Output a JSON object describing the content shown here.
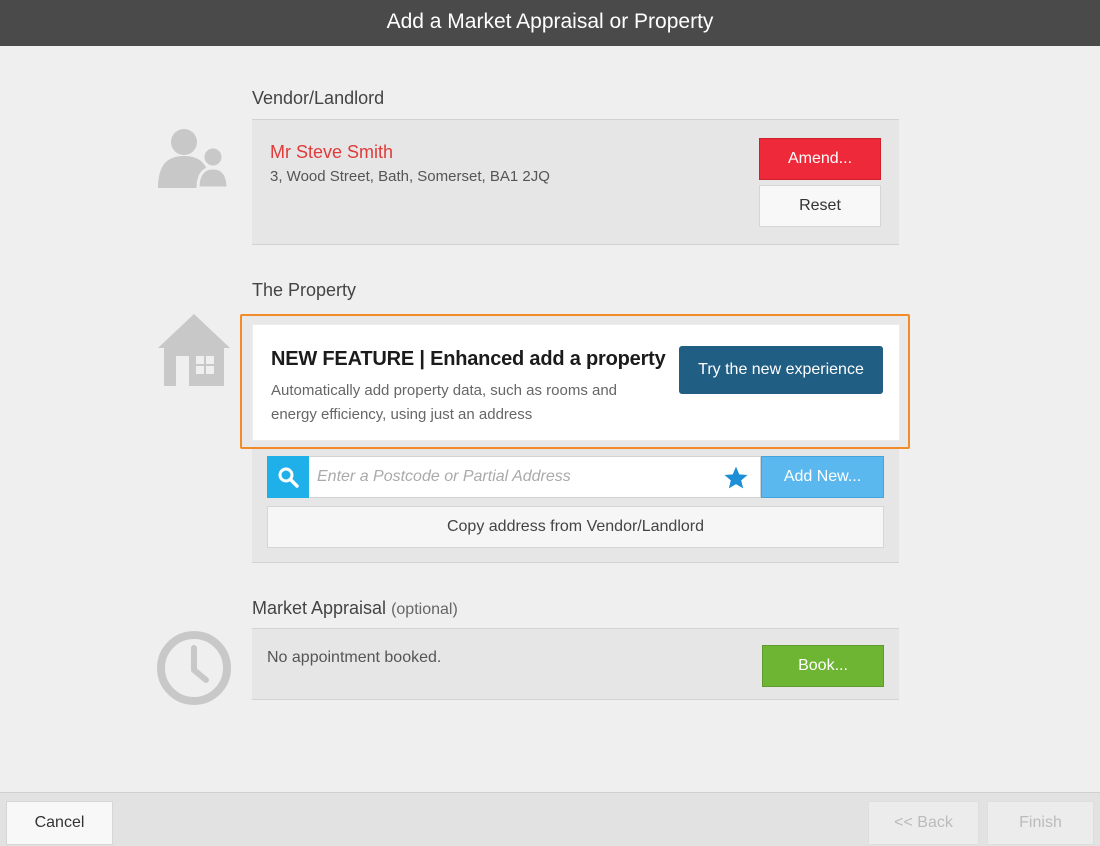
{
  "window": {
    "title": "Add a Market Appraisal or Property"
  },
  "vendor": {
    "section_title": "Vendor/Landlord",
    "name": "Mr Steve Smith",
    "address": "3, Wood Street, Bath, Somerset, BA1 2JQ",
    "amend_label": "Amend...",
    "reset_label": "Reset",
    "icon": "people-icon"
  },
  "property": {
    "section_title": "The Property",
    "icon": "house-icon",
    "feature": {
      "title": "NEW FEATURE | Enhanced add a property",
      "description": "Automatically add property data, such as rooms and energy efficiency, using just an address",
      "button_label": "Try the new experience"
    },
    "search": {
      "placeholder": "Enter a Postcode or Partial Address",
      "value": ""
    },
    "add_new_label": "Add New...",
    "copy_label": "Copy address from Vendor/Landlord"
  },
  "appraisal": {
    "section_title": "Market Appraisal",
    "section_note": "(optional)",
    "icon": "clock-icon",
    "status_text": "No appointment booked.",
    "book_label": "Book..."
  },
  "footer": {
    "cancel_label": "Cancel",
    "back_label": "<< Back",
    "finish_label": "Finish"
  },
  "colors": {
    "titlebar": "#4a4a4a",
    "vendor_name": "#e03a3a",
    "amend": "#ee2a3a",
    "highlight_border": "#f28c28",
    "try_button": "#215e84",
    "search_button": "#1fb0ea",
    "add_new": "#5ab8ef",
    "book": "#6fb534"
  }
}
